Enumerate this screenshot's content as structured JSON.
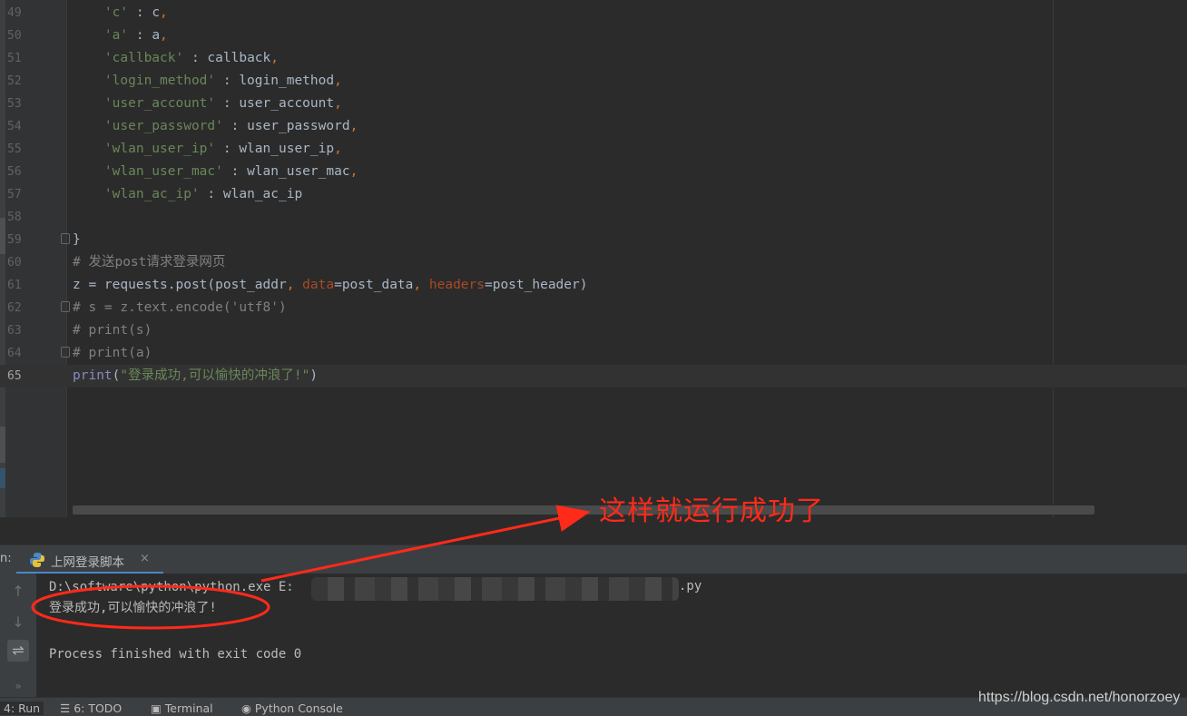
{
  "editor": {
    "lines": [
      {
        "num": "49",
        "segments": [
          {
            "t": "    ",
            "c": ""
          },
          {
            "t": "'c'",
            "c": "str"
          },
          {
            "t": " : c",
            "c": ""
          },
          {
            "t": ",",
            "c": "kw"
          }
        ]
      },
      {
        "num": "50",
        "segments": [
          {
            "t": "    ",
            "c": ""
          },
          {
            "t": "'a'",
            "c": "str"
          },
          {
            "t": " : a",
            "c": ""
          },
          {
            "t": ",",
            "c": "kw"
          }
        ]
      },
      {
        "num": "51",
        "segments": [
          {
            "t": "    ",
            "c": ""
          },
          {
            "t": "'callback'",
            "c": "str"
          },
          {
            "t": " : callback",
            "c": ""
          },
          {
            "t": ",",
            "c": "kw"
          }
        ]
      },
      {
        "num": "52",
        "segments": [
          {
            "t": "    ",
            "c": ""
          },
          {
            "t": "'login_method'",
            "c": "str"
          },
          {
            "t": " : login_method",
            "c": ""
          },
          {
            "t": ",",
            "c": "kw"
          }
        ]
      },
      {
        "num": "53",
        "segments": [
          {
            "t": "    ",
            "c": ""
          },
          {
            "t": "'user_account'",
            "c": "str"
          },
          {
            "t": " : user_account",
            "c": ""
          },
          {
            "t": ",",
            "c": "kw"
          }
        ]
      },
      {
        "num": "54",
        "segments": [
          {
            "t": "    ",
            "c": ""
          },
          {
            "t": "'user_password'",
            "c": "str"
          },
          {
            "t": " : user_password",
            "c": ""
          },
          {
            "t": ",",
            "c": "kw"
          }
        ]
      },
      {
        "num": "55",
        "segments": [
          {
            "t": "    ",
            "c": ""
          },
          {
            "t": "'wlan_user_ip'",
            "c": "str"
          },
          {
            "t": " : wlan_user_ip",
            "c": ""
          },
          {
            "t": ",",
            "c": "kw"
          }
        ]
      },
      {
        "num": "56",
        "segments": [
          {
            "t": "    ",
            "c": ""
          },
          {
            "t": "'wlan_user_mac'",
            "c": "str"
          },
          {
            "t": " : wlan_user_mac",
            "c": ""
          },
          {
            "t": ",",
            "c": "kw"
          }
        ]
      },
      {
        "num": "57",
        "segments": [
          {
            "t": "    ",
            "c": ""
          },
          {
            "t": "'wlan_ac_ip'",
            "c": "str"
          },
          {
            "t": " : wlan_ac_ip",
            "c": ""
          }
        ]
      },
      {
        "num": "58",
        "segments": []
      },
      {
        "num": "59",
        "segments": [
          {
            "t": "}",
            "c": ""
          }
        ]
      },
      {
        "num": "60",
        "segments": [
          {
            "t": "# 发送post请求登录网页",
            "c": "cm"
          }
        ]
      },
      {
        "num": "61",
        "segments": [
          {
            "t": "z = requests.post(post_addr",
            "c": ""
          },
          {
            "t": ", ",
            "c": "kw"
          },
          {
            "t": "data",
            "c": "param"
          },
          {
            "t": "=post_data",
            "c": ""
          },
          {
            "t": ", ",
            "c": "kw"
          },
          {
            "t": "headers",
            "c": "param"
          },
          {
            "t": "=post_header)",
            "c": ""
          }
        ]
      },
      {
        "num": "62",
        "segments": [
          {
            "t": "# s = z.text.encode('utf8')",
            "c": "cm"
          }
        ]
      },
      {
        "num": "63",
        "segments": [
          {
            "t": "# print(s)",
            "c": "cm"
          }
        ]
      },
      {
        "num": "64",
        "segments": [
          {
            "t": "# print(a)",
            "c": "cm"
          }
        ]
      },
      {
        "num": "65",
        "current": true,
        "segments": [
          {
            "t": "print",
            "c": "bi"
          },
          {
            "t": "(",
            "c": ""
          },
          {
            "t": "\"登录成功,可以愉快的冲浪了!\"",
            "c": "str"
          },
          {
            "t": ")",
            "c": ""
          }
        ]
      }
    ]
  },
  "run_panel": {
    "prefix": "n:",
    "tab_title": "上网登录脚本",
    "tab_close": "×",
    "command_prefix": "D:\\software\\python\\python.exe E:",
    "command_suffix": ".py",
    "output_line": "登录成功,可以愉快的冲浪了!",
    "exit_line": "Process finished with exit code 0",
    "tools": {
      "up": "↑",
      "down": "↓",
      "wrap": "⇌",
      "more": "»"
    }
  },
  "bottom_bar": {
    "run": "4: Run",
    "todo": "6: TODO",
    "terminal": "Terminal",
    "python_console": "Python Console"
  },
  "annotation": {
    "text": "这样就运行成功了",
    "color": "#ff2a1a"
  },
  "watermark": "https://blog.csdn.net/honorzoey"
}
